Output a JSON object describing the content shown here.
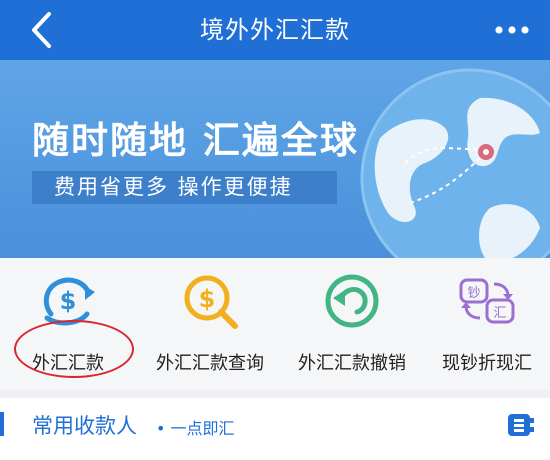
{
  "nav": {
    "title": "境外外汇汇款",
    "back_icon": "chevron-left-icon",
    "more_icon": "more-dots-icon"
  },
  "banner": {
    "slogan": "随时随地 汇遍全球",
    "sub_slogan": "费用省更多 操作更便捷"
  },
  "features": [
    {
      "label": "外汇汇款",
      "icon": "dollar-transfer-icon",
      "color": "#2f8fd8"
    },
    {
      "label": "外汇汇款查询",
      "icon": "dollar-search-icon",
      "color": "#f2b01e"
    },
    {
      "label": "外汇汇款撤销",
      "icon": "undo-icon",
      "color": "#41b584"
    },
    {
      "label": "现钞折现汇",
      "icon": "cash-exchange-icon",
      "color": "#9b6fd0"
    }
  ],
  "payees": {
    "title": "常用收款人",
    "subtitle": "• 一点即汇"
  },
  "colors": {
    "primary": "#1f6fd6",
    "highlight": "#d9282f"
  }
}
